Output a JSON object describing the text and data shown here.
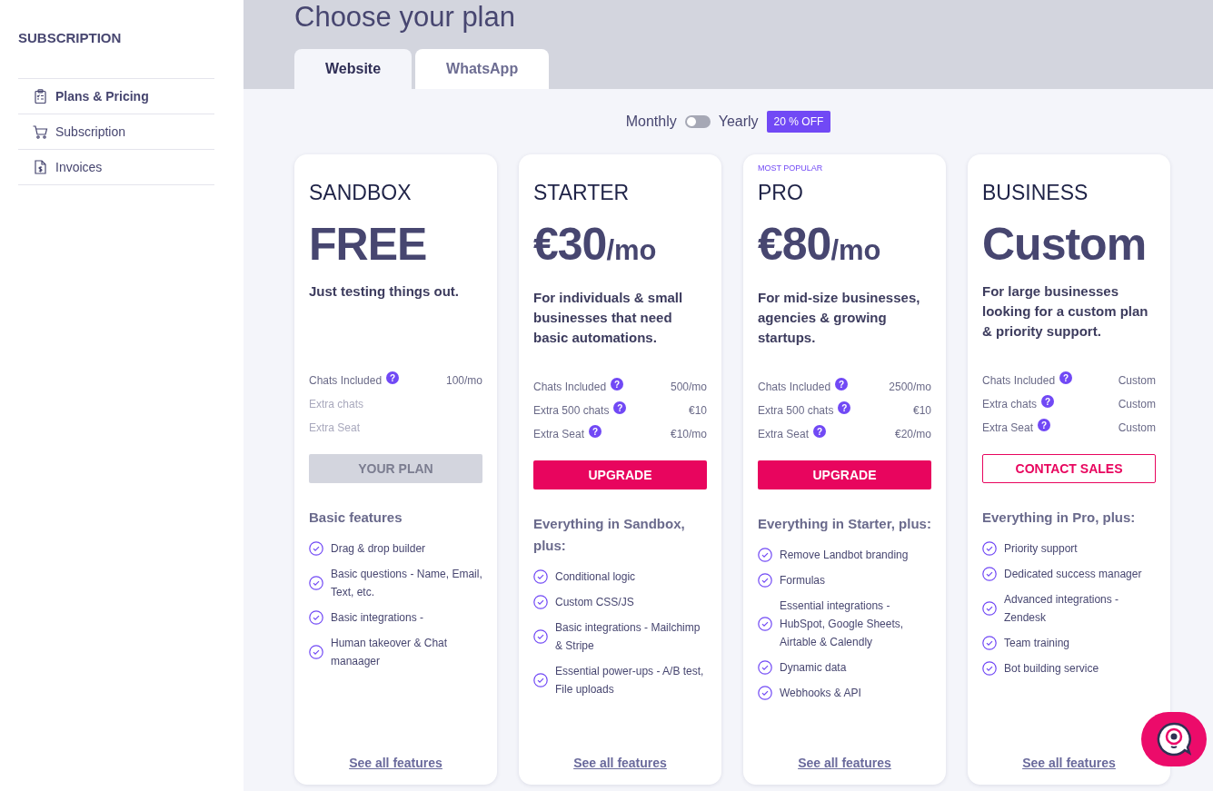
{
  "sidebar": {
    "title": "SUBSCRIPTION",
    "items": [
      {
        "label": "Plans & Pricing",
        "kind": "clipboard",
        "selected": true
      },
      {
        "label": "Subscription",
        "kind": "cart",
        "selected": false
      },
      {
        "label": "Invoices",
        "kind": "invoice",
        "selected": false
      }
    ]
  },
  "header": {
    "title": "Choose your plan",
    "tabs": [
      {
        "label": "Website",
        "selected": true
      },
      {
        "label": "WhatsApp",
        "selected": false
      }
    ]
  },
  "billing": {
    "monthly": "Monthly",
    "yearly": "Yearly",
    "on": false,
    "badge": "20 % OFF"
  },
  "plans": [
    {
      "name": "SANDBOX",
      "price": "FREE",
      "description": "Just testing things out.",
      "specs": [
        {
          "label": "Chats Included",
          "help": "?",
          "value": "100/mo",
          "faded": false
        },
        {
          "label": "Extra chats",
          "faded": true
        },
        {
          "label": "Extra Seat",
          "faded": true
        }
      ],
      "button": {
        "label": "YOUR PLAN",
        "kind": "current"
      },
      "features_title": "Basic features",
      "features": [
        "Drag & drop builder",
        "Basic questions - Name, Email, Text, etc.",
        "Basic integrations -",
        "Human takeover & Chat manaager"
      ],
      "link": "See all features"
    },
    {
      "name": "STARTER",
      "price": "€30",
      "period": "/mo",
      "description": "For individuals & small businesses that need basic automations.",
      "specs": [
        {
          "label": "Chats Included",
          "help": "?",
          "value": "500/mo",
          "faded": false
        },
        {
          "label": "Extra 500 chats",
          "help": "?",
          "value": "€10",
          "faded": false
        },
        {
          "label": "Extra Seat",
          "help": "?",
          "value": "€10/mo",
          "faded": false
        }
      ],
      "button": {
        "label": "UPGRADE",
        "kind": "primary"
      },
      "features_title": "Everything in Sandbox, plus:",
      "features": [
        "Conditional logic",
        "Custom CSS/JS",
        "Basic integrations - Mailchimp & Stripe",
        "Essential power-ups - A/B test, File uploads"
      ],
      "link": "See all features"
    },
    {
      "tag": "MOST POPULAR",
      "name": "PRO",
      "price": "€80",
      "period": "/mo",
      "description": "For mid-size businesses, agencies & growing startups.",
      "specs": [
        {
          "label": "Chats Included",
          "help": "?",
          "value": "2500/mo",
          "faded": false
        },
        {
          "label": "Extra 500 chats",
          "help": "?",
          "value": "€10",
          "faded": false
        },
        {
          "label": "Extra Seat",
          "help": "?",
          "value": "€20/mo",
          "faded": false
        }
      ],
      "button": {
        "label": "UPGRADE",
        "kind": "primary"
      },
      "features_title": "Everything in Starter, plus:",
      "features": [
        "Remove Landbot branding",
        "Formulas",
        "Essential integrations - HubSpot, Google Sheets, Airtable & Calendly",
        "Dynamic data",
        "Webhooks & API"
      ],
      "link": "See all features"
    },
    {
      "name": "BUSINESS",
      "price": "Custom",
      "description": "For large businesses looking for a custom plan & priority support.",
      "specs": [
        {
          "label": "Chats Included",
          "help": "?",
          "value": "Custom",
          "faded": false
        },
        {
          "label": "Extra chats",
          "help": "?",
          "value": "Custom",
          "faded": false
        },
        {
          "label": "Extra Seat",
          "help": "?",
          "value": "Custom",
          "faded": false
        }
      ],
      "button": {
        "label": "CONTACT SALES",
        "kind": "outline"
      },
      "features_title": "Everything in Pro, plus:",
      "features": [
        "Priority support",
        "Dedicated success manager",
        "Advanced integrations - Zendesk",
        "Team training",
        "Bot building service"
      ],
      "link": "See all features"
    }
  ]
}
